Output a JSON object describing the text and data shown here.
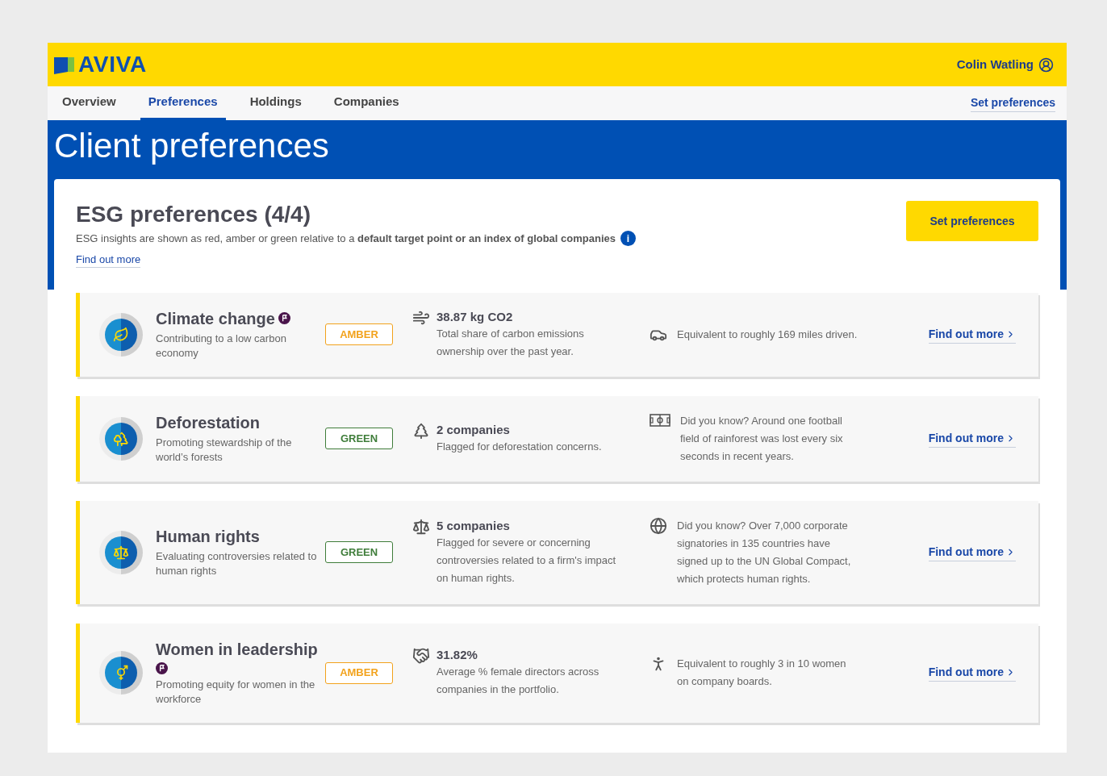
{
  "brand": {
    "name": "AVIVA"
  },
  "user": {
    "name": "Colin Watling"
  },
  "nav": {
    "tabs": [
      {
        "label": "Overview",
        "selected": false
      },
      {
        "label": "Preferences",
        "selected": true
      },
      {
        "label": "Holdings",
        "selected": false
      },
      {
        "label": "Companies",
        "selected": false
      }
    ],
    "link": "Set preferences"
  },
  "page_title": "Client preferences",
  "esg": {
    "title": "ESG preferences (4/4)",
    "description": "ESG insights are shown as red, amber or green relative to a **default target point or an index of global companies**",
    "info_icon": "i",
    "link": "Find out more",
    "button": "Set preferences"
  },
  "preferences": [
    {
      "kind": "climate",
      "title": "Climate change",
      "flagged": true,
      "subtitle": "Contributing to a low carbon economy",
      "rating": "AMBER",
      "color": "#f2a21c",
      "stat_value": "38.87 kg CO2",
      "stat_text": "Total share of carbon emissions ownership over the past year.",
      "fact": "Equivalent to roughly 169 miles driven.",
      "link": "Find out more"
    },
    {
      "kind": "forest",
      "title": "Deforestation",
      "flagged": false,
      "subtitle": "Promoting stewardship of the world’s forests",
      "rating": "GREEN",
      "color": "#3f7d3a",
      "stat_value": "2 companies",
      "stat_text": "Flagged for deforestation concerns.",
      "fact": "Did you know? Around one football field of rainforest was lost every six seconds in recent years.",
      "link": "Find out more"
    },
    {
      "kind": "rights",
      "title": "Human rights",
      "flagged": false,
      "subtitle": "Evaluating controversies related to human rights",
      "rating": "GREEN",
      "color": "#3f7d3a",
      "stat_value": "5 companies",
      "stat_text": "Flagged for severe or concerning controversies related to a firm's impact on human rights.",
      "fact": "Did you know? Over 7,000 corporate signatories in 135 countries have signed up to the UN Global Compact, which protects human rights.",
      "link": "Find out more"
    },
    {
      "kind": "gender",
      "title": "Women in leadership",
      "flagged": true,
      "subtitle": "Promoting equity for women in the workforce",
      "rating": "AMBER",
      "color": "#f2a21c",
      "stat_value": "31.82%",
      "stat_text": "Average % female directors across companies in the portfolio.",
      "fact": "Equivalent to roughly 3 in 10 women on company boards.",
      "link": "Find out more"
    }
  ]
}
